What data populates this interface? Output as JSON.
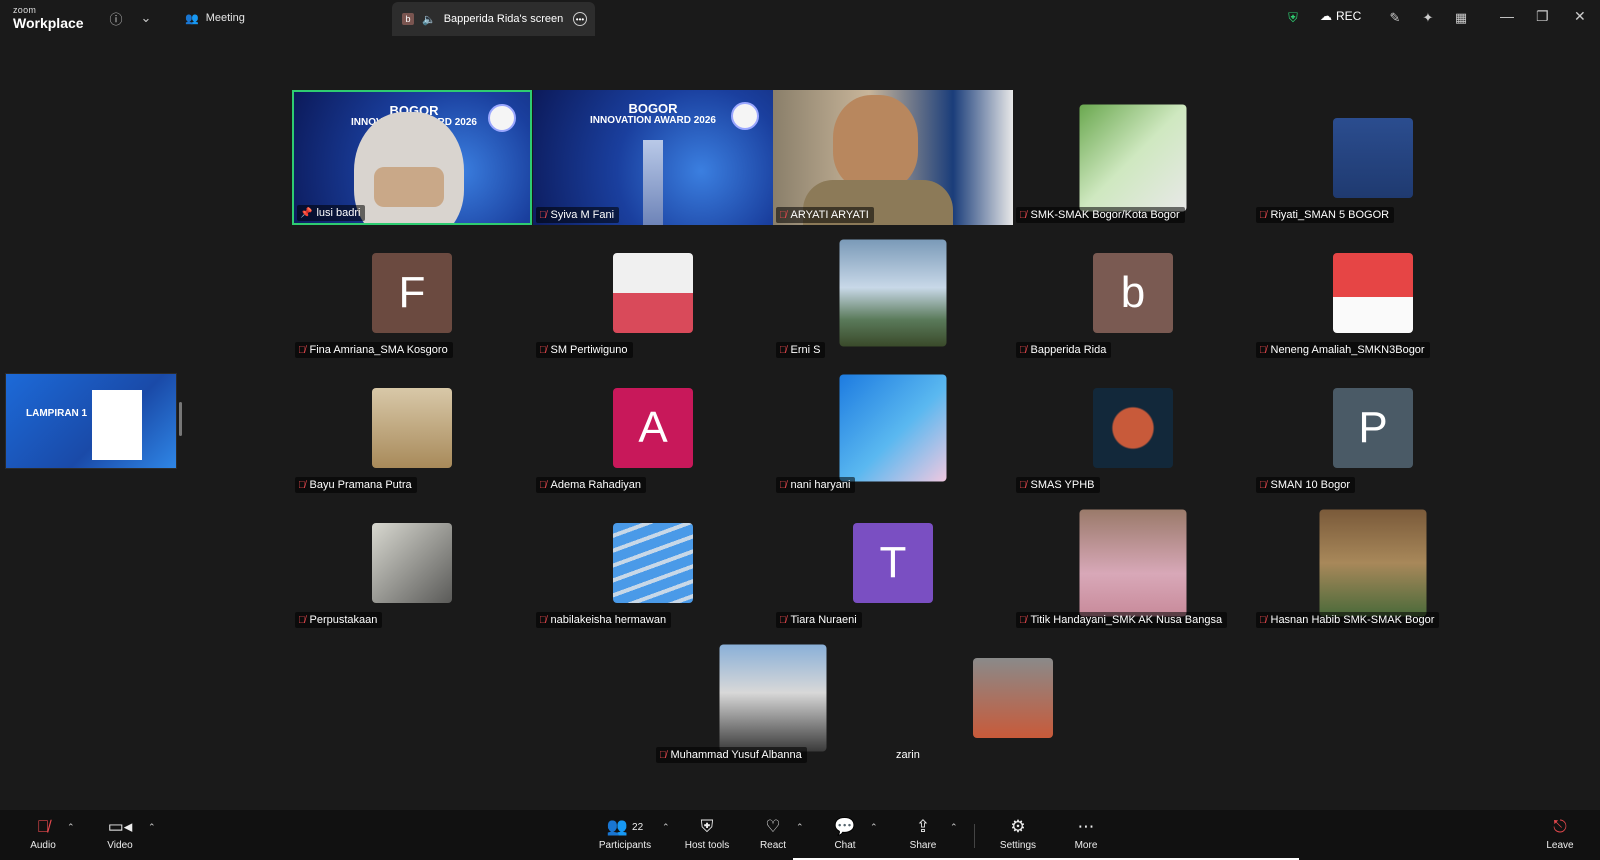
{
  "app": {
    "brand_small": "zoom",
    "brand_big": "Workplace"
  },
  "tabs": {
    "meeting": "Meeting",
    "screen": "Bapperida Rida's screen",
    "screen_badge": "b"
  },
  "topbar": {
    "rec": "REC"
  },
  "shared": {
    "title": "LAMPIRAN 1"
  },
  "participants": [
    {
      "name": "lusi badri",
      "kind": "video"
    },
    {
      "name": "Syiva M Fani",
      "kind": "video"
    },
    {
      "name": "ARYATI ARYATI",
      "kind": "video"
    },
    {
      "name": "SMK-SMAK Bogor/Kota Bogor",
      "kind": "photo"
    },
    {
      "name": "Riyati_SMAN 5 BOGOR",
      "kind": "photo"
    },
    {
      "name": "Fina Amriana_SMA Kosgoro",
      "kind": "avatar",
      "letter": "F",
      "color": "#6b4a40"
    },
    {
      "name": "SM Pertiwiguno",
      "kind": "photo"
    },
    {
      "name": "Erni S",
      "kind": "photo"
    },
    {
      "name": "Bapperida Rida",
      "kind": "avatar",
      "letter": "b",
      "color": "#7a5a52"
    },
    {
      "name": "Neneng Amaliah_SMKN3Bogor",
      "kind": "photo"
    },
    {
      "name": "Bayu Pramana Putra",
      "kind": "photo"
    },
    {
      "name": "Adema Rahadiyan",
      "kind": "avatar",
      "letter": "A",
      "color": "#c8185a"
    },
    {
      "name": "nani haryani",
      "kind": "photo"
    },
    {
      "name": "SMAS YPHB",
      "kind": "photo"
    },
    {
      "name": "SMAN 10 Bogor",
      "kind": "avatar",
      "letter": "P",
      "color": "#4a5a66"
    },
    {
      "name": "Perpustakaan",
      "kind": "photo"
    },
    {
      "name": "nabilakeisha hermawan",
      "kind": "photo"
    },
    {
      "name": "Tiara Nuraeni",
      "kind": "avatar",
      "letter": "T",
      "color": "#7a4fc2"
    },
    {
      "name": "Titik Handayani_SMK AK Nusa Bangsa",
      "kind": "photo"
    },
    {
      "name": "Hasnan Habib SMK-SMAK Bogor",
      "kind": "photo"
    },
    {
      "name": "Muhammad Yusuf Albanna",
      "kind": "photo"
    },
    {
      "name": "zarin",
      "kind": "photo"
    }
  ],
  "award": {
    "line1": "BOGOR",
    "line2": "INNOVATION AWARD 2026"
  },
  "toolbar": {
    "audio": "Audio",
    "video": "Video",
    "participants": "Participants",
    "participants_count": "22",
    "host_tools": "Host tools",
    "react": "React",
    "chat": "Chat",
    "share": "Share",
    "settings": "Settings",
    "more": "More",
    "leave": "Leave"
  }
}
